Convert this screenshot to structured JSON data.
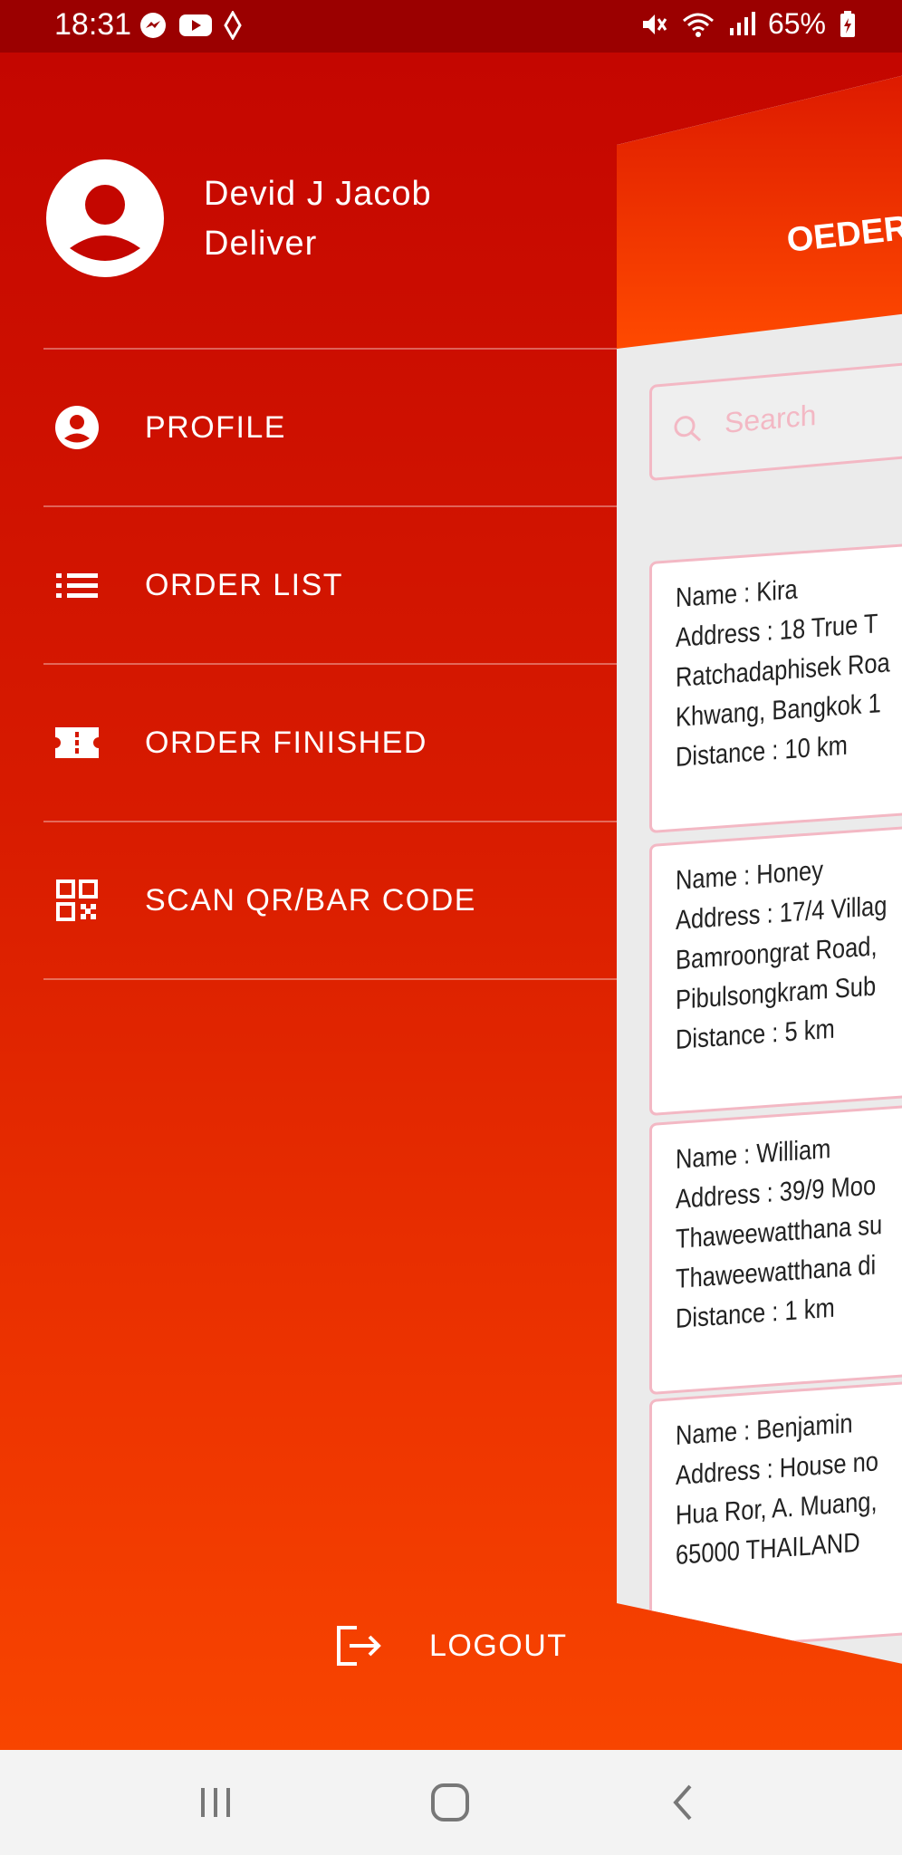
{
  "status_bar": {
    "time": "18:31",
    "battery": "65%",
    "left_icons": [
      "messenger-icon",
      "youtube-icon",
      "vpn-icon"
    ],
    "right_icons": [
      "mute-icon",
      "wifi-icon",
      "signal-icon",
      "battery-icon"
    ]
  },
  "user": {
    "name": "Devid J Jacob",
    "role": "Deliver"
  },
  "menu": [
    {
      "label": "PROFILE",
      "icon": "profile-icon"
    },
    {
      "label": "ORDER LIST",
      "icon": "list-icon"
    },
    {
      "label": "ORDER FINISHED",
      "icon": "ticket-icon"
    },
    {
      "label": "SCAN QR/BAR CODE",
      "icon": "qr-code-icon"
    }
  ],
  "logout_label": "LOGOUT",
  "preview": {
    "title": "OEDER",
    "search_placeholder": "Search",
    "cards": [
      {
        "lines": [
          "Name : Kira",
          "Address : 18 True T",
          "Ratchadaphisek Roa",
          "Khwang, Bangkok 1",
          "Distance : 10 km"
        ]
      },
      {
        "lines": [
          "Name : Honey",
          "Address : 17/4 Villag",
          "Bamroongrat Road,",
          "Pibulsongkram Sub",
          "Distance : 5 km"
        ]
      },
      {
        "lines": [
          "Name : William",
          "Address : 39/9 Moo",
          "Thaweewatthana su",
          "Thaweewatthana di",
          "Distance : 1 km"
        ]
      },
      {
        "lines": [
          "Name : Benjamin",
          "Address : House no",
          "Hua Ror, A. Muang,",
          "65000 THAILAND"
        ]
      }
    ]
  },
  "colors": {
    "drawer_top": "#c40600",
    "drawer_bottom": "#f84500",
    "status_bar": "#9b0000",
    "card_border": "#f3b8c4"
  },
  "nav_bar": {
    "buttons": [
      "recent-apps-icon",
      "home-icon",
      "back-icon"
    ]
  }
}
